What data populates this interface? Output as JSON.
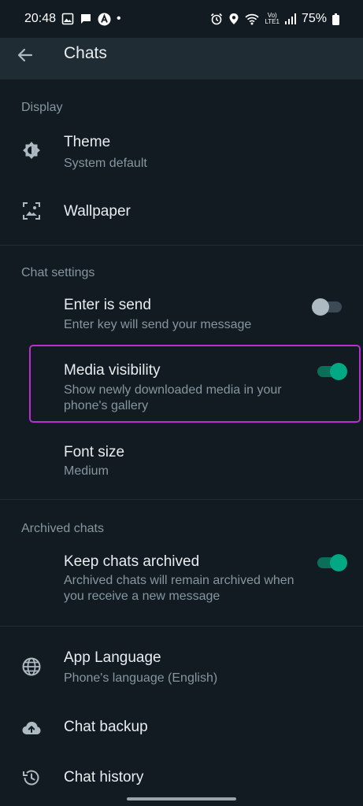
{
  "status_bar": {
    "time": "20:48",
    "dot": "•",
    "battery": "75%",
    "volte_line1": "Vo)",
    "volte_line2": "LTE1"
  },
  "app_bar": {
    "title": "Chats"
  },
  "sections": {
    "display": {
      "header": "Display",
      "theme": {
        "title": "Theme",
        "subtitle": "System default"
      },
      "wallpaper": {
        "title": "Wallpaper"
      }
    },
    "chat_settings": {
      "header": "Chat settings",
      "enter_is_send": {
        "title": "Enter is send",
        "subtitle": "Enter key will send your message",
        "enabled": false
      },
      "media_visibility": {
        "title": "Media visibility",
        "subtitle": "Show newly downloaded media in your phone's gallery",
        "enabled": true
      },
      "font_size": {
        "title": "Font size",
        "subtitle": "Medium"
      }
    },
    "archived_chats": {
      "header": "Archived chats",
      "keep_archived": {
        "title": "Keep chats archived",
        "subtitle": "Archived chats will remain archived when you receive a new message",
        "enabled": true
      }
    },
    "other": {
      "app_language": {
        "title": "App Language",
        "subtitle": "Phone's language (English)"
      },
      "chat_backup": {
        "title": "Chat backup"
      },
      "chat_history": {
        "title": "Chat history"
      }
    }
  },
  "colors": {
    "background": "#111b21",
    "app_bar": "#202c33",
    "accent_green": "#00a884",
    "highlight_border": "#b92fd0",
    "secondary_text": "#8696a0"
  },
  "icons": {
    "back": "arrow-left-icon",
    "theme": "brightness-icon",
    "wallpaper": "wallpaper-icon",
    "app_language": "globe-icon",
    "chat_backup": "cloud-upload-icon",
    "chat_history": "history-icon"
  }
}
